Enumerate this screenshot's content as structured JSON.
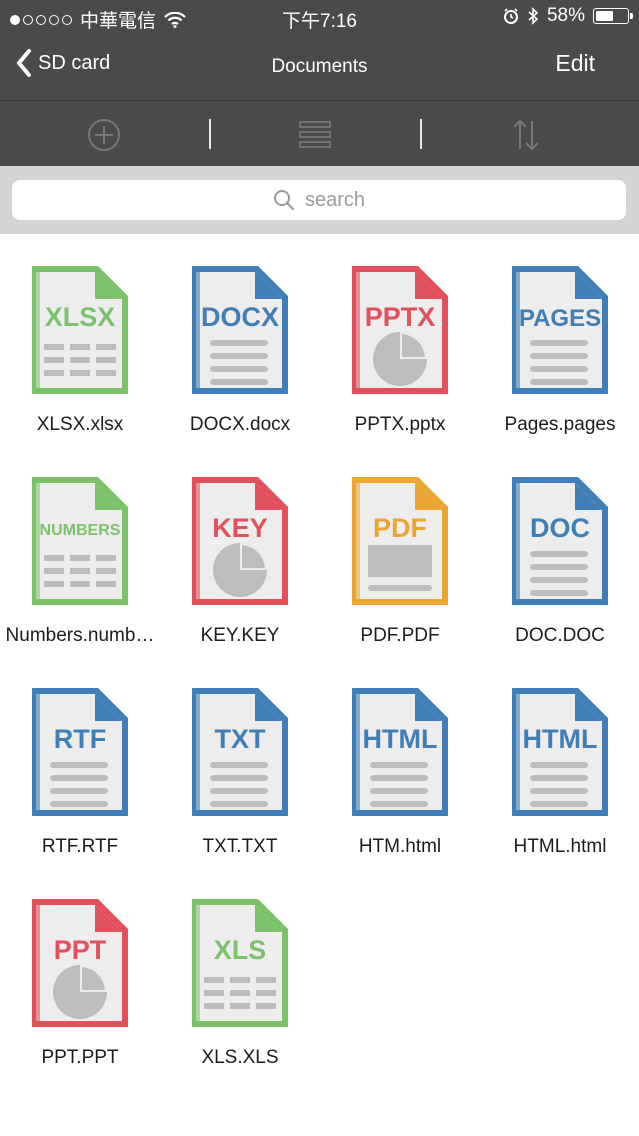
{
  "status_bar": {
    "carrier": "中華電信",
    "time": "下午7:16",
    "battery": "58%",
    "battery_level": 0.58,
    "signal_dots_filled": 1
  },
  "nav": {
    "back_label": "SD card",
    "title": "Documents",
    "edit_label": "Edit"
  },
  "toolbar": {
    "add_icon": "plus-circle-icon",
    "list_icon": "list-view-icon",
    "sort_icon": "sort-icon"
  },
  "search": {
    "placeholder": "search"
  },
  "files": [
    {
      "badge": "XLSX",
      "name": "XLSX.xlsx",
      "color": "#7cc26b",
      "style": "table"
    },
    {
      "badge": "DOCX",
      "name": "DOCX.docx",
      "color": "#3f7eb6",
      "style": "lines"
    },
    {
      "badge": "PPTX",
      "name": "PPTX.pptx",
      "color": "#e2505b",
      "style": "pie"
    },
    {
      "badge": "PAGES",
      "name": "Pages.pages",
      "color": "#3f7eb6",
      "style": "lines"
    },
    {
      "badge": "NUMBERS",
      "name": "Numbers.numb…",
      "color": "#7cc26b",
      "style": "table"
    },
    {
      "badge": "KEY",
      "name": "KEY.KEY",
      "color": "#e2505b",
      "style": "pie"
    },
    {
      "badge": "PDF",
      "name": "PDF.PDF",
      "color": "#eba532",
      "style": "pdf"
    },
    {
      "badge": "DOC",
      "name": "DOC.DOC",
      "color": "#3f7eb6",
      "style": "lines"
    },
    {
      "badge": "RTF",
      "name": "RTF.RTF",
      "color": "#3f7eb6",
      "style": "lines"
    },
    {
      "badge": "TXT",
      "name": "TXT.TXT",
      "color": "#3f7eb6",
      "style": "lines"
    },
    {
      "badge": "HTML",
      "name": "HTM.html",
      "color": "#3f7eb6",
      "style": "lines"
    },
    {
      "badge": "HTML",
      "name": "HTML.html",
      "color": "#3f7eb6",
      "style": "lines"
    },
    {
      "badge": "PPT",
      "name": "PPT.PPT",
      "color": "#e2505b",
      "style": "pie"
    },
    {
      "badge": "XLS",
      "name": "XLS.XLS",
      "color": "#7cc26b",
      "style": "table"
    }
  ]
}
